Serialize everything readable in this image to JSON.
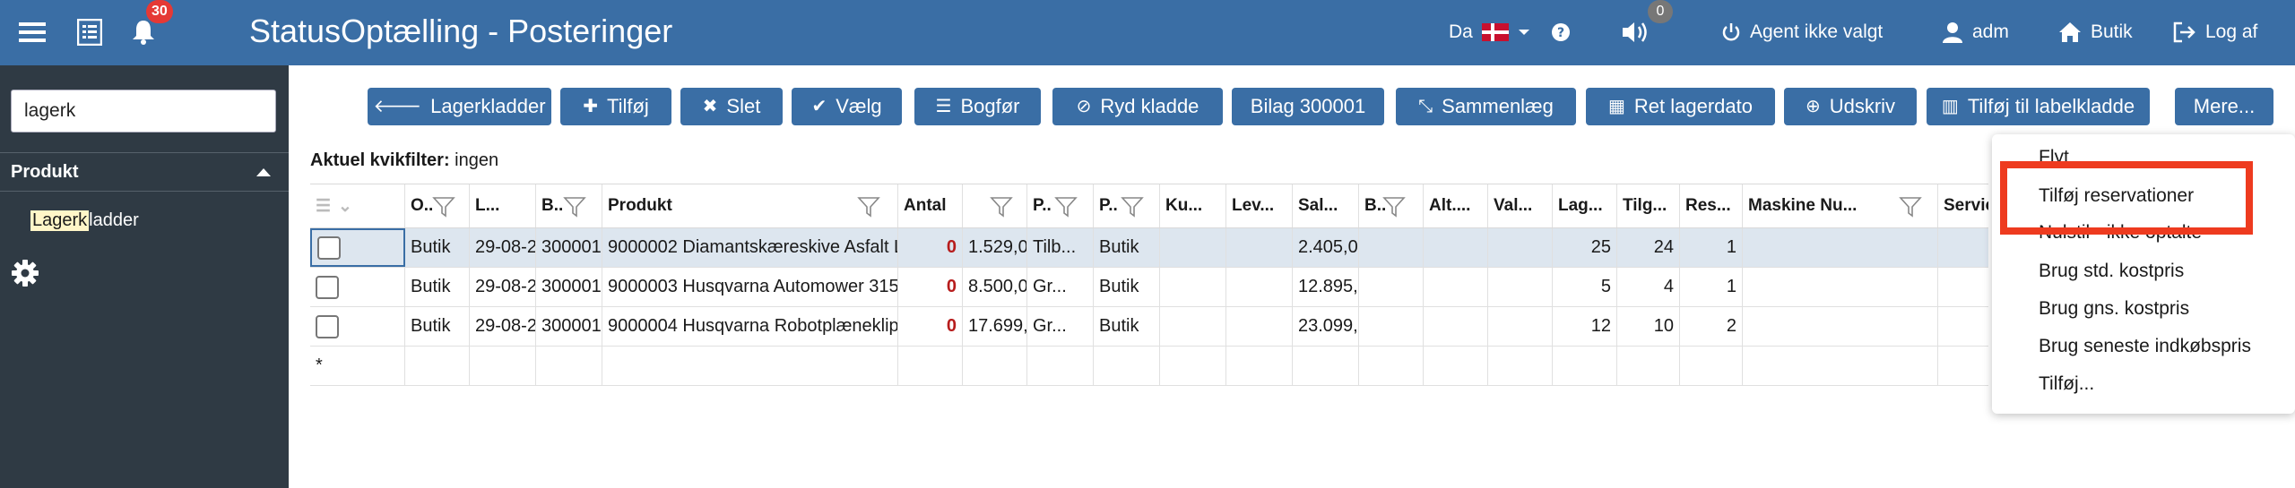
{
  "topbar": {
    "title": "StatusOptælling - Posteringer",
    "notification_count": "30",
    "sound_count": "0",
    "language": "Da",
    "agent": "Agent ikke valgt",
    "user": "adm",
    "shop": "Butik",
    "logout": "Log af",
    "colors": {
      "bar": "#3a6ea5",
      "badge": "#e53935"
    }
  },
  "sidebar": {
    "search_value": "lagerk",
    "section_label": "Produkt",
    "link_highlight": "Lagerk",
    "link_rest": "ladder"
  },
  "toolbar": {
    "buttons": [
      {
        "icon": "arrow-left-icon",
        "label": "Lagerkladder"
      },
      {
        "icon": "plus-icon",
        "label": "Tilføj"
      },
      {
        "icon": "x-icon",
        "label": "Slet"
      },
      {
        "icon": "check-icon",
        "label": "Vælg"
      },
      {
        "icon": "list-icon",
        "label": "Bogfør"
      },
      {
        "icon": "ban-icon",
        "label": "Ryd kladde"
      },
      {
        "icon": "",
        "label": "Bilag 300001"
      },
      {
        "icon": "compress-icon",
        "label": "Sammenlæg"
      },
      {
        "icon": "calendar-icon",
        "label": "Ret lagerdato"
      },
      {
        "icon": "download-icon",
        "label": "Udskriv"
      },
      {
        "icon": "barcode-icon",
        "label": "Tilføj til labelkladde"
      },
      {
        "icon": "",
        "label": "Mere..."
      }
    ]
  },
  "quickfilter": {
    "label": "Aktuel kvikfilter:",
    "value": "ingen"
  },
  "grid": {
    "columns": [
      "O..",
      "L...",
      "B..",
      "Produkt",
      "Antal",
      "",
      "P..",
      "P..",
      "Ku...",
      "Lev...",
      "Sal...",
      "B..",
      "Alt....",
      "Val...",
      "Lag...",
      "Tilg...",
      "Res...",
      "Maskine Nu...",
      "Servic"
    ],
    "rows": [
      [
        "Butik",
        "29-08-2",
        "300001",
        "9000002 Diamantskæreskive Asfalt L",
        "0",
        "1.529,0",
        "Tilb...",
        "Butik",
        "",
        "",
        "2.405,0",
        "",
        "",
        "",
        "25",
        "24",
        "1",
        "",
        ""
      ],
      [
        "Butik",
        "29-08-2",
        "300001",
        "9000003 Husqvarna Automower 315",
        "0",
        "8.500,0",
        "Gr...",
        "Butik",
        "",
        "",
        "12.895,",
        "",
        "",
        "",
        "5",
        "4",
        "1",
        "",
        ""
      ],
      [
        "Butik",
        "29-08-2",
        "300001",
        "9000004 Husqvarna Robotplæneklip",
        "0",
        "17.699,",
        "Gr...",
        "Butik",
        "",
        "",
        "23.099,",
        "",
        "",
        "",
        "12",
        "10",
        "2",
        "",
        ""
      ]
    ],
    "new_row_marker": "*"
  },
  "dropdown": {
    "items": [
      "Flyt",
      "Tilføj reservationer",
      "Nulstil - ikke optalte",
      "Brug std. kostpris",
      "Brug gns. kostpris",
      "Brug seneste indkøbspris",
      "Tilføj..."
    ],
    "highlighted_index": 1,
    "highlight_color": "#ee3b1f"
  }
}
